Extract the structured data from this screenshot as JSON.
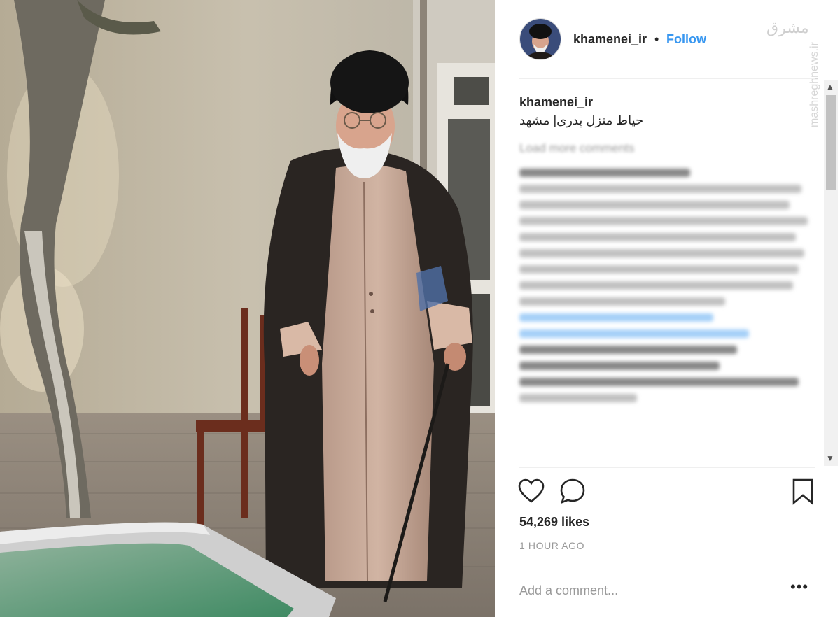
{
  "post": {
    "username": "khamenei_ir",
    "dot": "•",
    "follow_label": "Follow",
    "watermark_main": "مشرق",
    "watermark_side": "mashreghnews.ir",
    "caption_user": "khamenei_ir",
    "caption_text": "حیاط منزل پدری| مشهد",
    "load_more": "Load more comments",
    "likes": "54,269 likes",
    "time": "1 HOUR AGO",
    "add_comment_placeholder": "Add a comment...",
    "more_glyph": "•••"
  },
  "icons": {
    "avatar": "avatar",
    "like": "heart-icon",
    "comment": "comment-bubble-icon",
    "save": "bookmark-icon",
    "more": "more-options-icon"
  },
  "colors": {
    "link": "#3897f0",
    "text": "#262626",
    "muted": "#999999"
  }
}
